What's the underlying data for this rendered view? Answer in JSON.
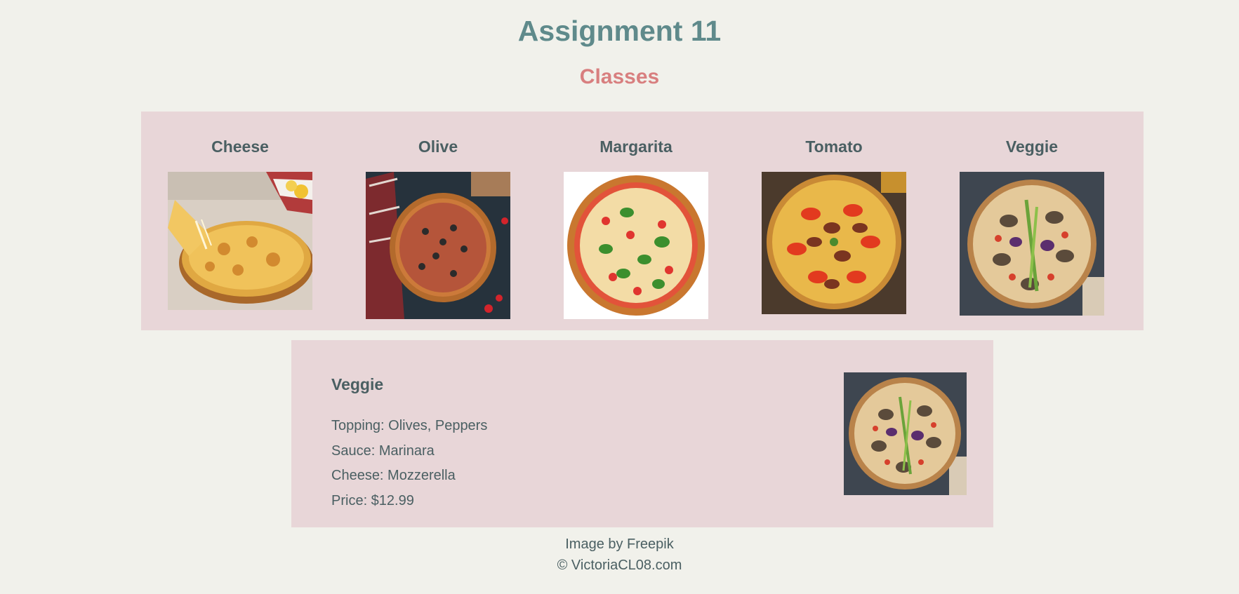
{
  "header": {
    "title": "Assignment 11",
    "subtitle": "Classes"
  },
  "gallery": {
    "items": [
      {
        "label": "Cheese",
        "icon": "cheese-pizza-image"
      },
      {
        "label": "Olive",
        "icon": "olive-pizza-image"
      },
      {
        "label": "Margarita",
        "icon": "margarita-pizza-image"
      },
      {
        "label": "Tomato",
        "icon": "tomato-pizza-image"
      },
      {
        "label": "Veggie",
        "icon": "veggie-pizza-image"
      }
    ]
  },
  "detail": {
    "title": "Veggie",
    "topping": "Topping: Olives, Peppers",
    "sauce": "Sauce: Marinara",
    "cheese": "Cheese: Mozzerella",
    "price": "Price: $12.99",
    "icon": "veggie-pizza-image"
  },
  "footer": {
    "credit": "Image by Freepik",
    "copyright": "© VictoriaCL08.com"
  },
  "colors": {
    "background": "#f1f1eb",
    "panel": "#e8d6d8",
    "title": "#5f8a8b",
    "subtitle": "#d87f7f",
    "text": "#4a5f62"
  }
}
